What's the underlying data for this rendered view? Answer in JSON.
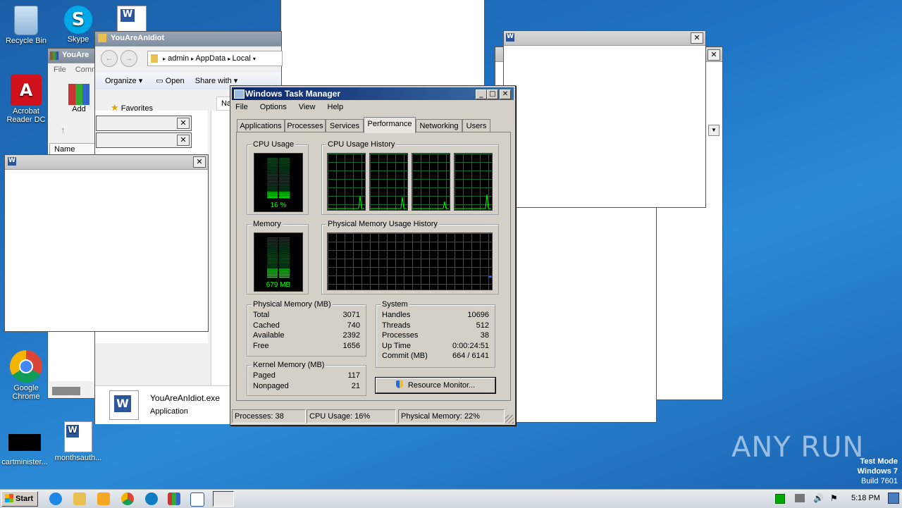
{
  "desktop": {
    "icons": [
      {
        "label": "Recycle Bin"
      },
      {
        "label": "Skype"
      },
      {
        "label": "Acrobat Reader DC"
      },
      {
        "label": "Google Chrome"
      },
      {
        "label": "cartminister..."
      },
      {
        "label": "monthsauth..."
      }
    ],
    "watermark": "ANY RUN",
    "test_mode": {
      "line1": "Test Mode",
      "line2": "Windows 7",
      "line3": "Build 7601"
    }
  },
  "explorer": {
    "title": "YouAreAnIdiot",
    "breadcrumb": [
      "admin",
      "AppData",
      "Local"
    ],
    "toolbar": {
      "organize": "Organize",
      "open": "Open",
      "share": "Share with"
    },
    "nav_favorites": "Favorites",
    "file_name": "YouAreAnIdiot.exe",
    "file_type": "Application",
    "column_name_partial": "Na"
  },
  "winrar": {
    "title": "YouAre",
    "menu": [
      "File",
      "Comm"
    ],
    "add_label": "Add",
    "column_name": "Name"
  },
  "taskmgr": {
    "title": "Windows Task Manager",
    "menu": [
      "File",
      "Options",
      "View",
      "Help"
    ],
    "tabs": [
      "Applications",
      "Processes",
      "Services",
      "Performance",
      "Networking",
      "Users"
    ],
    "active_tab": "Performance",
    "cpu_usage": {
      "label": "CPU Usage",
      "value": "16 %",
      "percent": 16
    },
    "cpu_history": {
      "label": "CPU Usage History"
    },
    "memory": {
      "label": "Memory",
      "value": "679 MB",
      "percent": 22
    },
    "mem_history": {
      "label": "Physical Memory Usage History"
    },
    "physical_memory": {
      "label": "Physical Memory (MB)",
      "rows": [
        {
          "k": "Total",
          "v": "3071"
        },
        {
          "k": "Cached",
          "v": "740"
        },
        {
          "k": "Available",
          "v": "2392"
        },
        {
          "k": "Free",
          "v": "1656"
        }
      ]
    },
    "kernel_memory": {
      "label": "Kernel Memory (MB)",
      "rows": [
        {
          "k": "Paged",
          "v": "117"
        },
        {
          "k": "Nonpaged",
          "v": "21"
        }
      ]
    },
    "system": {
      "label": "System",
      "rows": [
        {
          "k": "Handles",
          "v": "10696"
        },
        {
          "k": "Threads",
          "v": "512"
        },
        {
          "k": "Processes",
          "v": "38"
        },
        {
          "k": "Up Time",
          "v": "0:00:24:51"
        },
        {
          "k": "Commit (MB)",
          "v": "664 / 6141"
        }
      ]
    },
    "resource_monitor_button": "Resource Monitor...",
    "status": {
      "processes": "Processes: 38",
      "cpu": "CPU Usage: 16%",
      "memory": "Physical Memory: 22%"
    }
  },
  "taskbar": {
    "start_label": "Start",
    "clock": "5:18 PM"
  },
  "colors": {
    "graph_green": "#00ff00",
    "grid_green": "#0b6b3a",
    "title_blue": "#0a246a"
  }
}
